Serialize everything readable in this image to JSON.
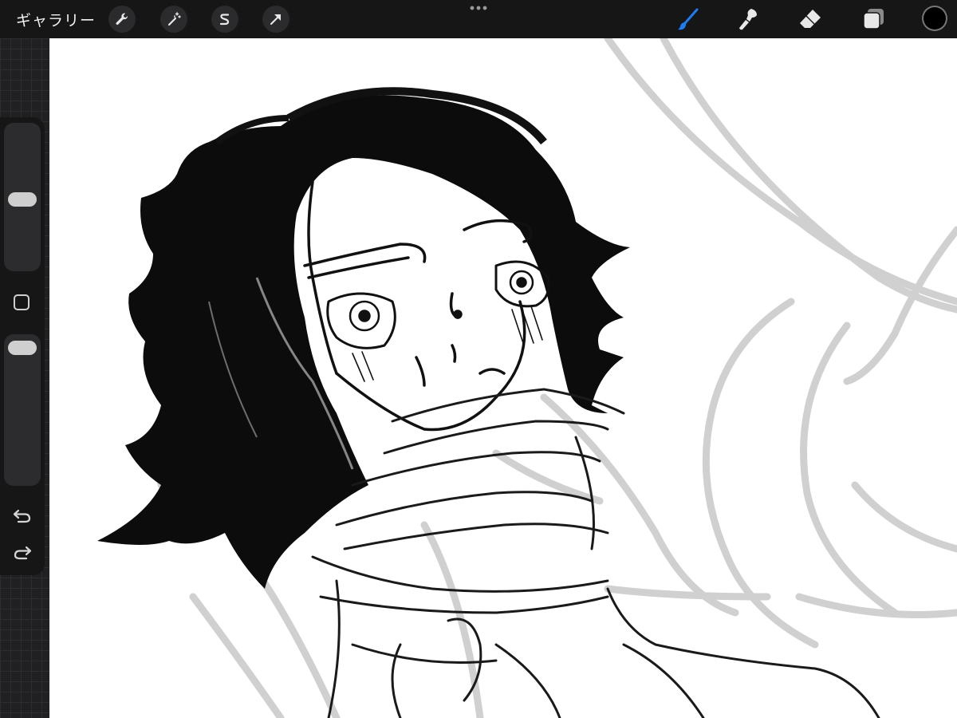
{
  "toolbar": {
    "gallery_label": "ギャラリー",
    "left_tools": [
      "wrench-icon",
      "magic-wand-icon",
      "selection-s-icon",
      "transform-arrow-icon"
    ],
    "right_tools": [
      "brush-icon",
      "smudge-icon",
      "eraser-icon",
      "layers-icon"
    ],
    "active_tool": "brush-icon",
    "accent_color": "#1e7cf2",
    "current_color": "#000000"
  },
  "sidebar": {
    "brush_size_level": 0.5,
    "opacity_level": 1.0,
    "undo_icon": "undo-icon",
    "redo_icon": "redo-icon"
  },
  "canvas": {
    "background": "#ffffff",
    "sketch_color": "#000000",
    "underlayer_color": "#cfcfcf"
  }
}
